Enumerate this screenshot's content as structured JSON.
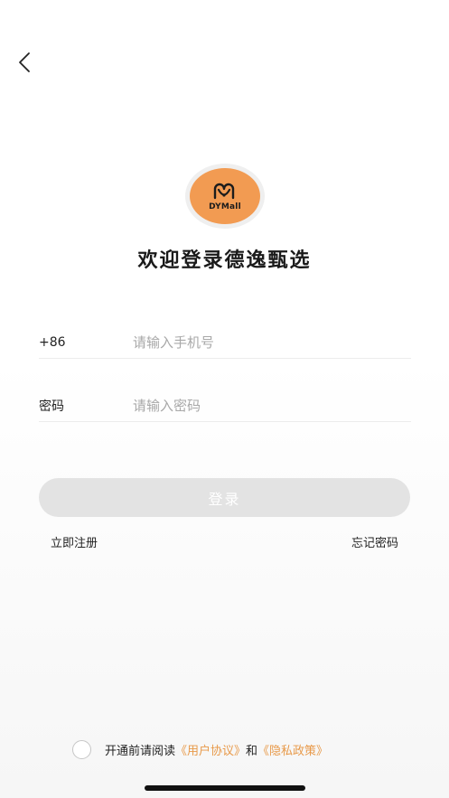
{
  "logo": {
    "text": "DYMall",
    "color": "#f29b52"
  },
  "welcome_title": "欢迎登录德逸甄选",
  "phone_field": {
    "prefix": "+86",
    "placeholder": "请输入手机号"
  },
  "password_field": {
    "label": "密码",
    "placeholder": "请输入密码"
  },
  "login_button": {
    "label": "登录"
  },
  "links": {
    "register": "立即注册",
    "forgot_password": "忘记密码"
  },
  "agreement": {
    "prefix": "开通前请阅读",
    "user_agreement": "《用户协议》",
    "and": "和",
    "privacy_policy": "《隐私政策》",
    "accent_color": "#e89a4a"
  },
  "icons": {
    "back": "chevron-left-icon",
    "agreement_check": "radio-circle-icon"
  }
}
